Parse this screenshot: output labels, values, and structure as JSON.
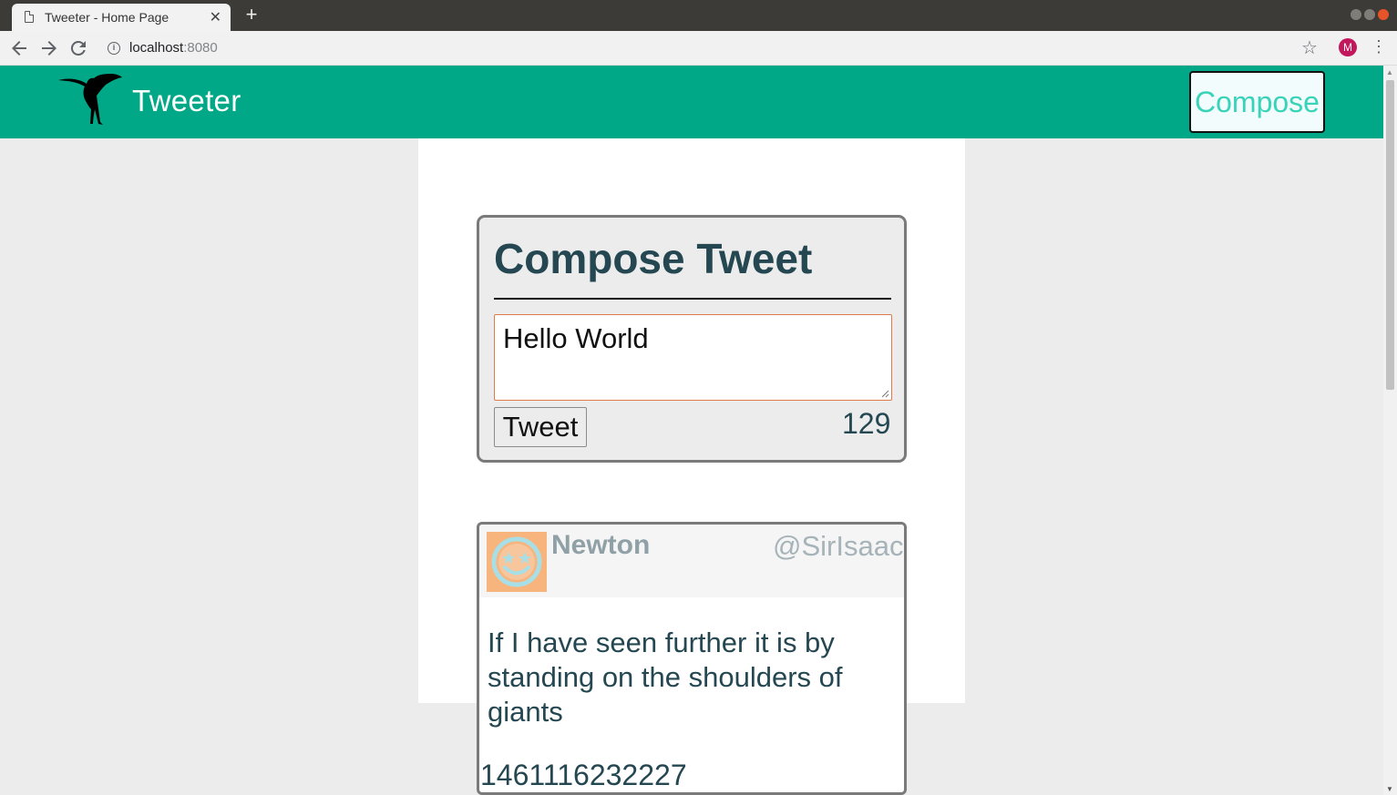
{
  "browser": {
    "tab_title": "Tweeter - Home Page",
    "tab_close": "✕",
    "new_tab": "+",
    "url_host": "localhost",
    "url_port": ":8080",
    "profile_initial": "M"
  },
  "nav": {
    "brand": "Tweeter",
    "compose_label": "Compose",
    "logo": "hummingbird-logo"
  },
  "compose": {
    "title": "Compose Tweet",
    "text_value": "Hello World",
    "tweet_button": "Tweet",
    "counter": "129"
  },
  "tweets": [
    {
      "author": "Newton",
      "handle": "@SirIsaac",
      "text": "If I have seen further it is by standing on the shoulders of giants",
      "created_at": "1461116232227",
      "avatar_icon": "smiley-star-eyes-icon"
    }
  ],
  "colors": {
    "header": "#00a887",
    "heading_text": "#244751",
    "compose_button_text": "#39d3b9",
    "avatar_bg": "#f8b47d"
  }
}
